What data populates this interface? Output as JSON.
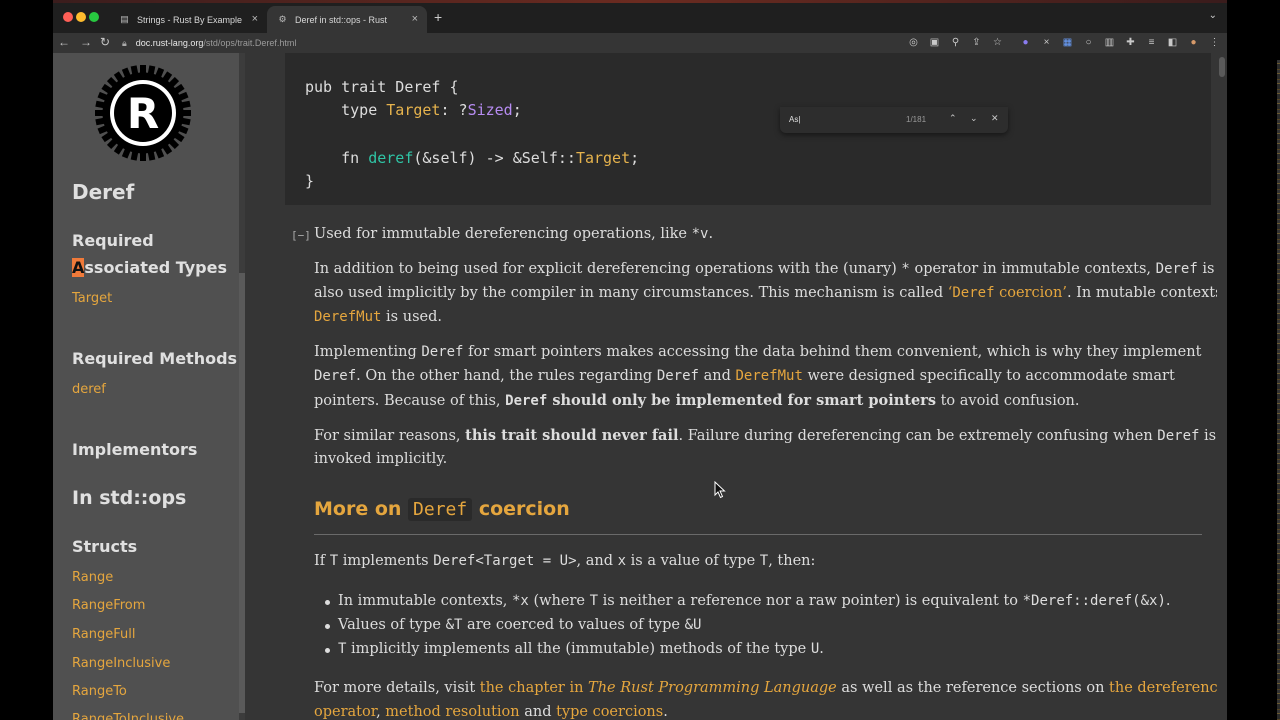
{
  "browser": {
    "tabs": [
      {
        "title": "Strings - Rust By Example",
        "active": false
      },
      {
        "title": "Deref in std::ops - Rust",
        "active": true
      }
    ],
    "new_tab": "+",
    "url_host": "doc.rust-lang.org",
    "url_path": "/std/ops/trait.Deref.html"
  },
  "find": {
    "query": "As|",
    "count": "1/181",
    "prev": "⌃",
    "next": "⌄",
    "close": "✕"
  },
  "sidebar": {
    "title": "Deref",
    "section_assoc_1": "Required",
    "section_assoc_2_a": "A",
    "section_assoc_2_rest": "ssociated Types",
    "assoc_item": "Target",
    "section_methods": "Required Methods",
    "method_item": "deref",
    "section_impl": "Implementors",
    "section_module": "In std::ops",
    "section_structs": "Structs",
    "structs": [
      "Range",
      "RangeFrom",
      "RangeFull",
      "RangeInclusive",
      "RangeTo",
      "RangeToInclusive"
    ]
  },
  "code": {
    "line1": "pub trait Deref {",
    "line2_a": "    type ",
    "line2_b": "Target",
    "line2_c": ": ?",
    "line2_d": "Sized",
    "line2_e": ";",
    "line3_a": "    fn ",
    "line3_b": "deref",
    "line3_c": "(&self) -> &Self::",
    "line3_d": "Target",
    "line3_e": ";",
    "line4": "}"
  },
  "doc": {
    "toggle": "[−]",
    "summary_a": "Used for immutable dereferencing operations, like ",
    "summary_code": "*v",
    "summary_b": ".",
    "p1_l1_a": "In addition to being used for explicit dereferencing operations with the (unary) ",
    "p1_l1_code1": "*",
    "p1_l1_b": " operator in immutable contexts, ",
    "p1_l1_code2": "Deref",
    "p1_l1_c": " is",
    "p1_l2_a": "also used implicitly by the compiler in many circumstances. This mechanism is called ",
    "p1_l2_link1": "‘",
    "p1_l2_linkcode": "Deref",
    "p1_l2_link2": " coercion’",
    "p1_l2_b": ". In mutable contexts,",
    "p1_l3_code": "DerefMut",
    "p1_l3_a": " is used.",
    "p2_l1_a": "Implementing ",
    "p2_l1_code": "Deref",
    "p2_l1_b": " for smart pointers makes accessing the data behind them convenient, which is why they implement",
    "p2_l2_code1": "Deref",
    "p2_l2_a": ". On the other hand, the rules regarding ",
    "p2_l2_code2": "Deref",
    "p2_l2_b": " and ",
    "p2_l2_link": "DerefMut",
    "p2_l2_c": " were designed specifically to accommodate smart",
    "p2_l3_a": "pointers. Because of this, ",
    "p2_l3_code": "Deref",
    "p2_l3_bold": " should only be implemented for smart pointers",
    "p2_l3_b": " to avoid confusion.",
    "p3_l1_a": "For similar reasons, ",
    "p3_l1_bold": "this trait should never fail",
    "p3_l1_b": ". Failure during dereferencing can be extremely confusing when ",
    "p3_l1_code": "Deref",
    "p3_l1_c": " is",
    "p3_l2": "invoked implicitly.",
    "h2_a": "More on ",
    "h2_code": "Deref",
    "h2_b": " coercion",
    "p4_a": "If ",
    "p4_code1": "T",
    "p4_b": " implements ",
    "p4_code2": "Deref<Target = U>",
    "p4_c": ", and ",
    "p4_code3": "x",
    "p4_d": " is a value of type ",
    "p4_code4": "T",
    "p4_e": ", then:",
    "li1_a": "In immutable contexts, ",
    "li1_code1": "*x",
    "li1_b": " (where ",
    "li1_code2": "T",
    "li1_c": " is neither a reference nor a raw pointer) is equivalent to ",
    "li1_code3": "*Deref::deref(&x)",
    "li1_d": ".",
    "li2_a": "Values of type ",
    "li2_code1": "&T",
    "li2_b": " are coerced to values of type ",
    "li2_code2": "&U",
    "li3_code1": "T",
    "li3_a": " implicitly implements all the (immutable) methods of the type ",
    "li3_code2": "U",
    "li3_b": ".",
    "p5_a": "For more details, visit ",
    "p5_link1_a": "the chapter in ",
    "p5_link1_em": "The Rust Programming Language",
    "p5_b": " as well as the reference sections on ",
    "p5_link2": "the dereference",
    "p5_link2b": "operator",
    "p5_c": ", ",
    "p5_link3": "method resolution",
    "p5_d": " and ",
    "p5_link4": "type coercions",
    "p5_e": "."
  },
  "colors": {
    "link": "#e5a63e",
    "fn": "#2fc4a5",
    "sidebar_bg": "#505050",
    "main_bg": "#353535"
  }
}
